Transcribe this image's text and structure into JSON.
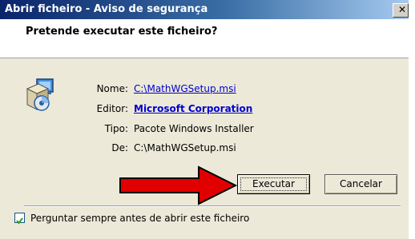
{
  "window": {
    "title": "Abrir ficheiro - Aviso de segurança",
    "close_glyph": "✕"
  },
  "question": "Pretende executar este ficheiro?",
  "fields": [
    {
      "label": "Nome:",
      "value": "C:\\MathWGSetup.msi"
    },
    {
      "label": "Editor:",
      "value": "Microsoft Corporation"
    },
    {
      "label": "Tipo:",
      "value": "Pacote Windows Installer"
    },
    {
      "label": "De:",
      "value": "C:\\MathWGSetup.msi"
    }
  ],
  "buttons": {
    "run": "Executar",
    "cancel": "Cancelar"
  },
  "checkbox": {
    "label": "Perguntar sempre antes de abrir este ficheiro",
    "checked": true
  },
  "icons": {
    "file": "windows-installer-package-icon",
    "annotation": "red-arrow-icon"
  },
  "colors": {
    "title_bar_start": "#0a246a",
    "title_bar_end": "#a6caf0",
    "link": "#0000cc",
    "arrow": "#e00000"
  }
}
